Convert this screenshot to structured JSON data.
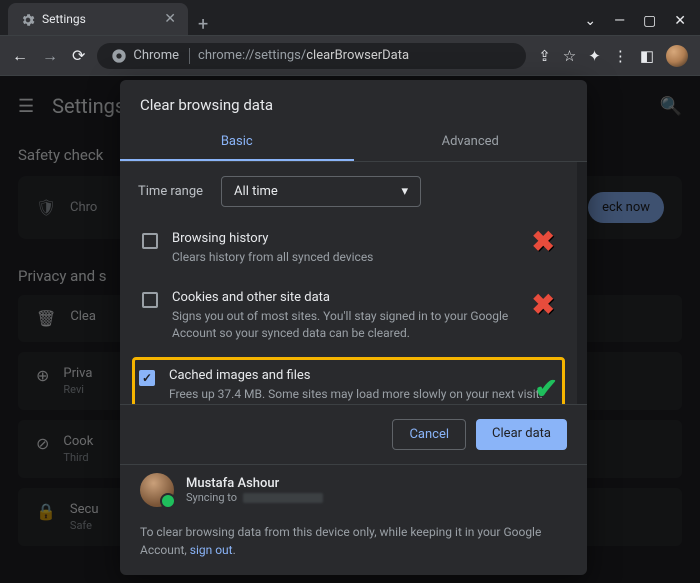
{
  "titlebar": {
    "tab_title": "Settings"
  },
  "omnibox": {
    "prefix_icon": "Chrome",
    "url_prefix": "chrome://settings/",
    "url_suffix": "clearBrowserData"
  },
  "backdrop": {
    "page_title": "Settings",
    "safety_label": "Safety check",
    "safety_text": "Chro",
    "check_now": "eck now",
    "privacy_label": "Privacy and s",
    "rows": [
      {
        "t": "Clea",
        "s": ""
      },
      {
        "t": "Priva",
        "s": "Revi"
      },
      {
        "t": "Cook",
        "s": "Third"
      },
      {
        "t": "Secu",
        "s": "Safe"
      }
    ]
  },
  "dialog": {
    "title": "Clear browsing data",
    "tab_basic": "Basic",
    "tab_advanced": "Advanced",
    "time_label": "Time range",
    "time_value": "All time",
    "options": [
      {
        "checked": false,
        "title": "Browsing history",
        "sub": "Clears history from all synced devices",
        "mark": "x"
      },
      {
        "checked": false,
        "title": "Cookies and other site data",
        "sub": "Signs you out of most sites. You'll stay signed in to your Google Account so your synced data can be cleared.",
        "mark": "x"
      },
      {
        "checked": true,
        "title": "Cached images and files",
        "sub": "Frees up 37.4 MB. Some sites may load more slowly on your next visit.",
        "mark": "check",
        "highlight": true
      }
    ],
    "cancel": "Cancel",
    "clear": "Clear data",
    "user_name": "Mustafa Ashour",
    "user_sync": "Syncing to",
    "note_a": "To clear browsing data from this device only, while keeping it in your Google Account, ",
    "note_link": "sign out",
    "note_b": "."
  }
}
